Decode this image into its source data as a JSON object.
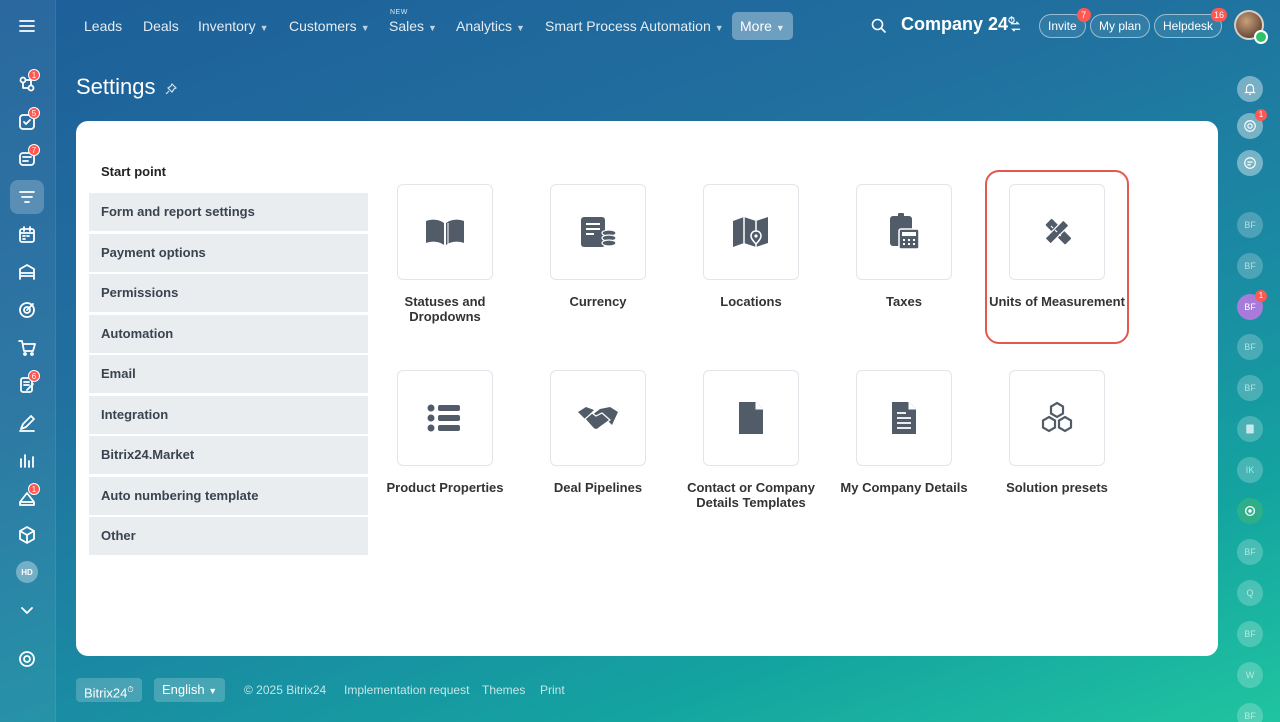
{
  "nav": {
    "leads": "Leads",
    "deals": "Deals",
    "inventory": "Inventory",
    "customers": "Customers",
    "sales": "Sales",
    "sales_badge": "NEW",
    "analytics": "Analytics",
    "spa": "Smart Process Automation",
    "more": "More"
  },
  "header": {
    "company": "Company 24",
    "invite": "Invite",
    "invite_badge": "7",
    "my_plan": "My plan",
    "helpdesk": "Helpdesk",
    "helpdesk_badge": "16"
  },
  "left_sidebar": {
    "badges": {
      "activity": "1",
      "tasks": "5",
      "chat": "7",
      "docs": "6",
      "crm": "1"
    },
    "hd_label": "HD"
  },
  "page": {
    "title": "Settings"
  },
  "menu": {
    "start": "Start point",
    "items": [
      "Form and report settings",
      "Payment options",
      "Permissions",
      "Automation",
      "Email",
      "Integration",
      "Bitrix24.Market",
      "Auto numbering template",
      "Other"
    ]
  },
  "tiles": [
    {
      "label": "Statuses and Dropdowns",
      "icon": "book-icon"
    },
    {
      "label": "Currency",
      "icon": "coins-icon"
    },
    {
      "label": "Locations",
      "icon": "map-icon"
    },
    {
      "label": "Taxes",
      "icon": "calculator-icon"
    },
    {
      "label": "Units of Measurement",
      "icon": "ruler-pencil-icon"
    },
    {
      "label": "Product Properties",
      "icon": "list-icon"
    },
    {
      "label": "Deal Pipelines",
      "icon": "handshake-icon"
    },
    {
      "label": "Contact or Company Details Templates",
      "icon": "document-icon"
    },
    {
      "label": "My Company Details",
      "icon": "document-lines-icon"
    },
    {
      "label": "Solution presets",
      "icon": "cubes-icon"
    }
  ],
  "right_sidebar": {
    "items": [
      "BF",
      "BF",
      "BF",
      "BF",
      "BF",
      "IK",
      "BF",
      "Q",
      "BF",
      "W",
      "BF"
    ],
    "badges": {
      "bell_target": "1",
      "bf_active": "1"
    }
  },
  "footer": {
    "brand": "Bitrix24",
    "language": "English",
    "copyright": "© 2025 Bitrix24",
    "implementation": "Implementation request",
    "themes": "Themes",
    "print": "Print"
  },
  "colors": {
    "highlight": "#e2594f",
    "badge": "#ff5752",
    "menu_bg": "#eaedf0",
    "icon": "#525c69"
  }
}
